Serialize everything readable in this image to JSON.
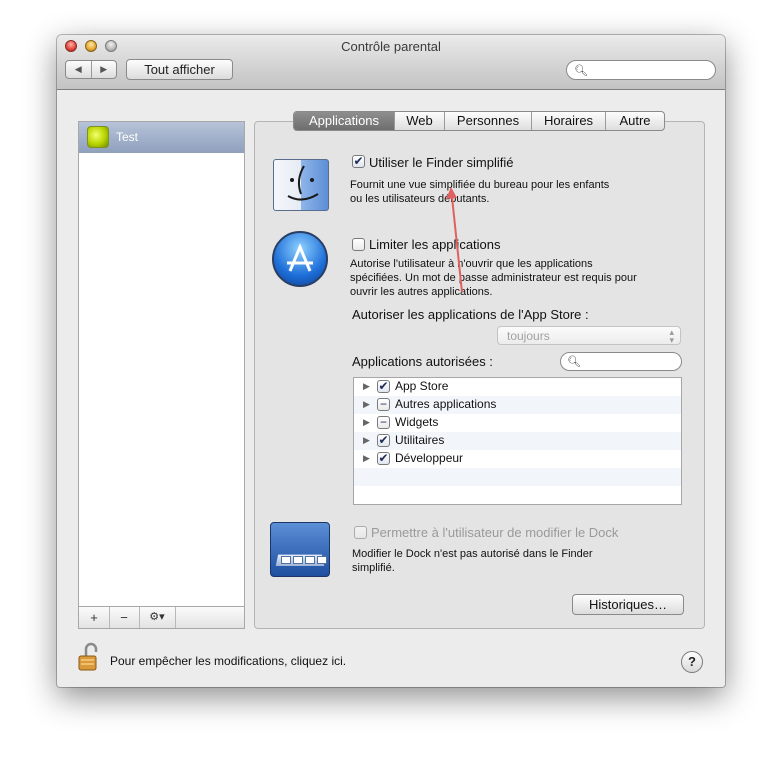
{
  "window": {
    "title": "Contrôle parental"
  },
  "toolbar": {
    "back_icon": "◀",
    "forward_icon": "▶",
    "show_all": "Tout afficher",
    "search_placeholder": ""
  },
  "sidebar": {
    "users": [
      {
        "name": "Test",
        "selected": true
      }
    ],
    "add_label": "+",
    "remove_label": "−",
    "action_label": "⚙▾"
  },
  "tabs": [
    {
      "label": "Applications",
      "active": true
    },
    {
      "label": "Web",
      "active": false
    },
    {
      "label": "Personnes",
      "active": false
    },
    {
      "label": "Horaires",
      "active": false
    },
    {
      "label": "Autre",
      "active": false
    }
  ],
  "finder": {
    "checkbox_label": "Utiliser le Finder simplifié",
    "checked": true,
    "description_line1": "Fournit une vue simplifiée du bureau pour les enfants",
    "description_line2": "ou les utilisateurs débutants."
  },
  "limit": {
    "checkbox_label": "Limiter les applications",
    "checked": false,
    "description_line1": "Autorise l'utilisateur à n'ouvrir que les applications",
    "description_line2": "spécifiées. Un mot de passe administrateur est requis pour",
    "description_line3": "ouvrir les autres applications."
  },
  "appstore": {
    "label": "Autoriser les applications de l'App Store :",
    "selected_value": "toujours"
  },
  "allowed": {
    "label": "Applications autorisées :",
    "search_placeholder": "",
    "items": [
      {
        "label": "App Store",
        "state": "checked"
      },
      {
        "label": "Autres applications",
        "state": "mixed"
      },
      {
        "label": "Widgets",
        "state": "mixed"
      },
      {
        "label": "Utilitaires",
        "state": "checked"
      },
      {
        "label": "Développeur",
        "state": "checked"
      }
    ]
  },
  "dock": {
    "checkbox_label": "Permettre à l'utilisateur de modifier le Dock",
    "enabled": false,
    "description_line1": "Modifier le Dock n'est pas autorisé dans le Finder",
    "description_line2": "simplifié."
  },
  "history_button": "Historiques…",
  "lock": {
    "text": "Pour empêcher les modifications, cliquez ici."
  },
  "help_label": "?",
  "colors": {
    "selection": "#8fa0bd",
    "accent": "#1e6fd9",
    "annotation_arrow": "#e06060"
  }
}
